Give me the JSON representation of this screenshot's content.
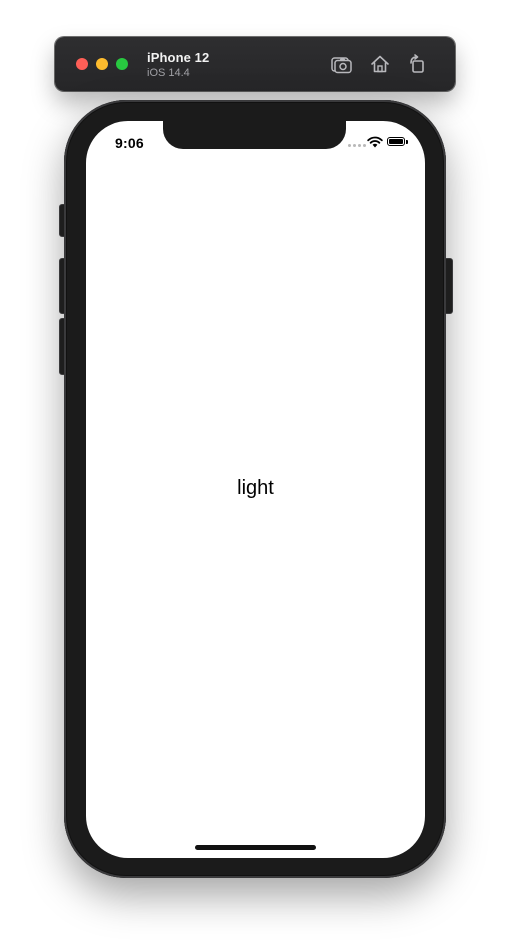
{
  "simulator": {
    "device_name": "iPhone 12",
    "os_version": "iOS 14.4",
    "buttons": {
      "screenshot_icon": "camera-icon",
      "home_icon": "home-icon",
      "rotate_icon": "rotate-icon"
    },
    "window_controls": [
      "close",
      "minimize",
      "zoom"
    ]
  },
  "status_bar": {
    "time": "9:06"
  },
  "app": {
    "label": "light"
  },
  "colors": {
    "toolbar_bg": "#2e2e30",
    "phone_frame": "#1b1b1b",
    "screen_bg": "#ffffff",
    "close": "#fe5f57",
    "minimize": "#febc2e",
    "zoom": "#28c840"
  }
}
